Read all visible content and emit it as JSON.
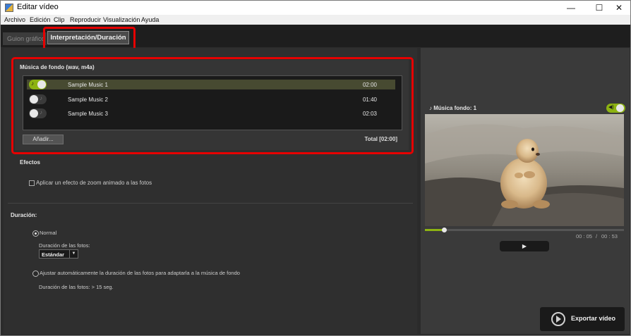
{
  "window": {
    "title": "Editar vídeo",
    "minimize": "—",
    "maximize": "☐",
    "close": "✕"
  },
  "menu": [
    "Archivo",
    "Edición",
    "Clip",
    "Reproducir",
    "Visualización",
    "Ayuda"
  ],
  "tabs": {
    "storyboard": "Guion gráfico",
    "active": "Interpretación/Duración"
  },
  "music": {
    "heading": "Música de fondo (wav, m4a)",
    "tracks": [
      {
        "name": "Sample Music 1",
        "duration": "02:00",
        "enabled": true
      },
      {
        "name": "Sample Music 2",
        "duration": "01:40",
        "enabled": false
      },
      {
        "name": "Sample Music 3",
        "duration": "02:03",
        "enabled": false
      }
    ],
    "add_button": "Añadir...",
    "total": "Total [02:00]"
  },
  "effects": {
    "heading": "Efectos",
    "zoom_label": "Aplicar un efecto de zoom animado a las fotos",
    "zoom_checked": false
  },
  "duration": {
    "heading": "Duración:",
    "normal_label": "Normal",
    "normal_selected": true,
    "photo_duration_label": "Duración de las fotos:",
    "photo_duration_value": "Estándar",
    "auto_label": "Ajustar automáticamente la duración de las fotos para adaptarla a la música de fondo",
    "auto_selected": false,
    "auto_info": "Duración de las fotos: > 15 seg."
  },
  "preview": {
    "bgm_label": "Música fondo: 1",
    "bgm_on": true,
    "current_time": "00 : 05",
    "separator": "/",
    "total_time": "00 : 53",
    "progress_fraction": 0.094,
    "play_glyph": "▶"
  },
  "export": {
    "label": "Exportar vídeo"
  },
  "colors": {
    "accent": "#8db312",
    "highlight": "#e60000"
  }
}
